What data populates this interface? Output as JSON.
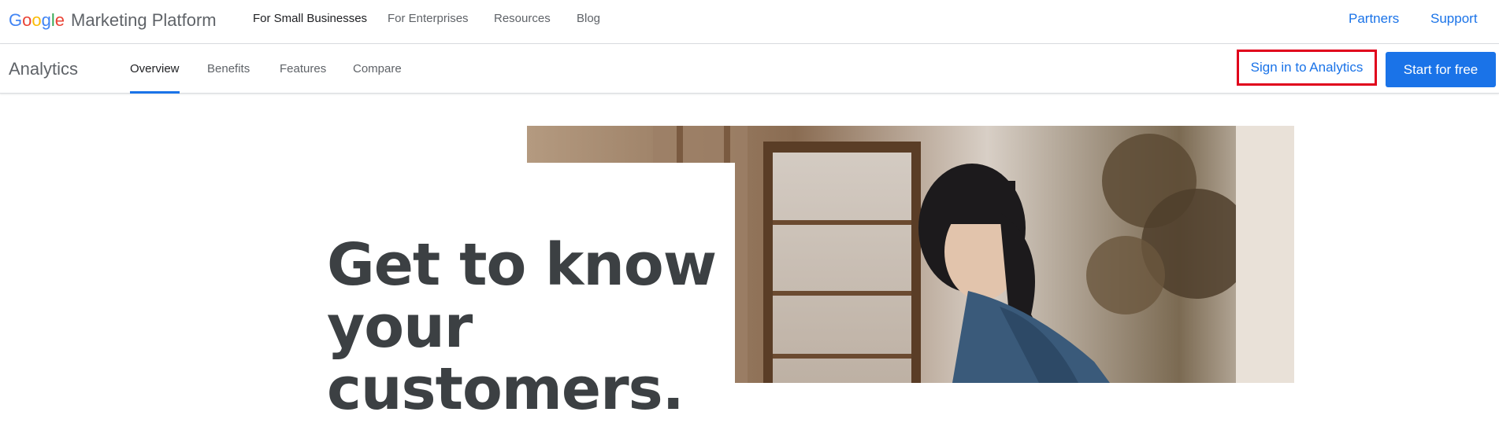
{
  "brand": {
    "google_letters": [
      {
        "char": "G",
        "color": "#4285F4"
      },
      {
        "char": "o",
        "color": "#EA4335"
      },
      {
        "char": "o",
        "color": "#FBBC05"
      },
      {
        "char": "g",
        "color": "#4285F4"
      },
      {
        "char": "l",
        "color": "#34A853"
      },
      {
        "char": "e",
        "color": "#EA4335"
      }
    ],
    "platform": "Marketing Platform"
  },
  "top_nav": {
    "items": [
      {
        "label": "For Small Businesses",
        "active": true
      },
      {
        "label": "For Enterprises"
      },
      {
        "label": "Resources"
      },
      {
        "label": "Blog"
      }
    ],
    "right": [
      {
        "label": "Partners"
      },
      {
        "label": "Support"
      }
    ]
  },
  "sub_nav": {
    "product": "Analytics",
    "tabs": [
      {
        "label": "Overview",
        "active": true
      },
      {
        "label": "Benefits"
      },
      {
        "label": "Features"
      },
      {
        "label": "Compare"
      }
    ],
    "signin_label": "Sign in to Analytics",
    "start_label": "Start for free"
  },
  "hero": {
    "headline_lines": [
      "Get to know",
      "your",
      "customers."
    ],
    "image": "woman-in-denim-jacket-in-shop-photo"
  },
  "colors": {
    "accent": "#1a73e8",
    "highlight_border": "#e0001b",
    "text_dark": "#202124",
    "text_muted": "#5f6368"
  }
}
